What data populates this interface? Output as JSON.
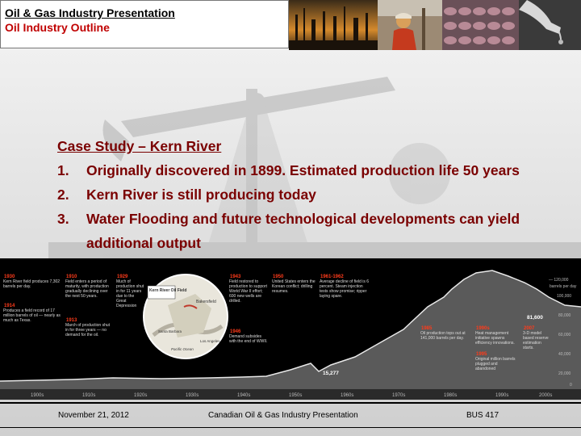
{
  "header": {
    "title": "Oil & Gas Industry Presentation",
    "subtitle": "Oil Industry Outline"
  },
  "main": {
    "heading": "Case Study – Kern River",
    "items": [
      {
        "num": "1.",
        "text": "Originally discovered in 1899. Estimated production life 50 years"
      },
      {
        "num": "2.",
        "text": "Kern River is still producing today"
      },
      {
        "num": "3.",
        "text": "Water Flooding and future technological developments can yield additional output"
      }
    ]
  },
  "timeline": {
    "events": [
      {
        "year": "1930",
        "text": "Kern River field produces 7,302 barrels per day."
      },
      {
        "year": "1914",
        "text": "Produces a field record of 17 million barrels of oil — nearly as much as Texas."
      },
      {
        "year": "1910",
        "text": "Field enters a period of maturity, with production gradually declining over the next 50 years."
      },
      {
        "year": "1913",
        "text": "March of production shut in for three years — no demand for the oil."
      },
      {
        "year": "1929",
        "text": "Much of production shut in for 11 years due to the Great Depression"
      },
      {
        "year": "1943",
        "text": "Field restored to production to support World War II effort; 600 new wells are drilled."
      },
      {
        "year": "1946",
        "text": "Demand subsides with the end of WWII."
      },
      {
        "year": "1950",
        "text": "United States enters the Korean conflict; drilling resumes."
      },
      {
        "year": "1961-1962",
        "text": "Average decline of field is 6 percent. Steam injection tests show promise; ripper laying spare."
      },
      {
        "year": "1985",
        "text": "Oil production tops out at 141,000 barrels per day."
      },
      {
        "year": "1990s",
        "text": "Heat management initiative spawns efficiency innovations."
      },
      {
        "year": "1995",
        "text": "Original million barrels plugged and abandoned"
      },
      {
        "year": "2007",
        "text": "3-D model based reserve estimation starts."
      }
    ],
    "map_label": "Kern River Oil Field",
    "map_places": [
      "Bakersfield",
      "Santa Barbara",
      "Los Angeles",
      "Pacific Ocean"
    ],
    "low_value": "15,277",
    "end_value": "81,600",
    "y_axis_unit": "barrels per day",
    "y_ticks": [
      "— 120,000",
      "100,000",
      "80,000",
      "60,000",
      "40,000",
      "20,000",
      "0"
    ],
    "decades": [
      "1900s",
      "1910s",
      "1920s",
      "1930s",
      "1940s",
      "1950s",
      "1960s",
      "1970s",
      "1980s",
      "1990s",
      "2000s"
    ]
  },
  "footer": {
    "date": "November 21, 2012",
    "org": "Canadian Oil & Gas Industry Presentation",
    "course": "BUS 417"
  },
  "colors": {
    "heading_red": "#c00000",
    "body_text": "#7a0000",
    "timeline_bg": "#000000",
    "event_year": "#ff3b1a"
  }
}
